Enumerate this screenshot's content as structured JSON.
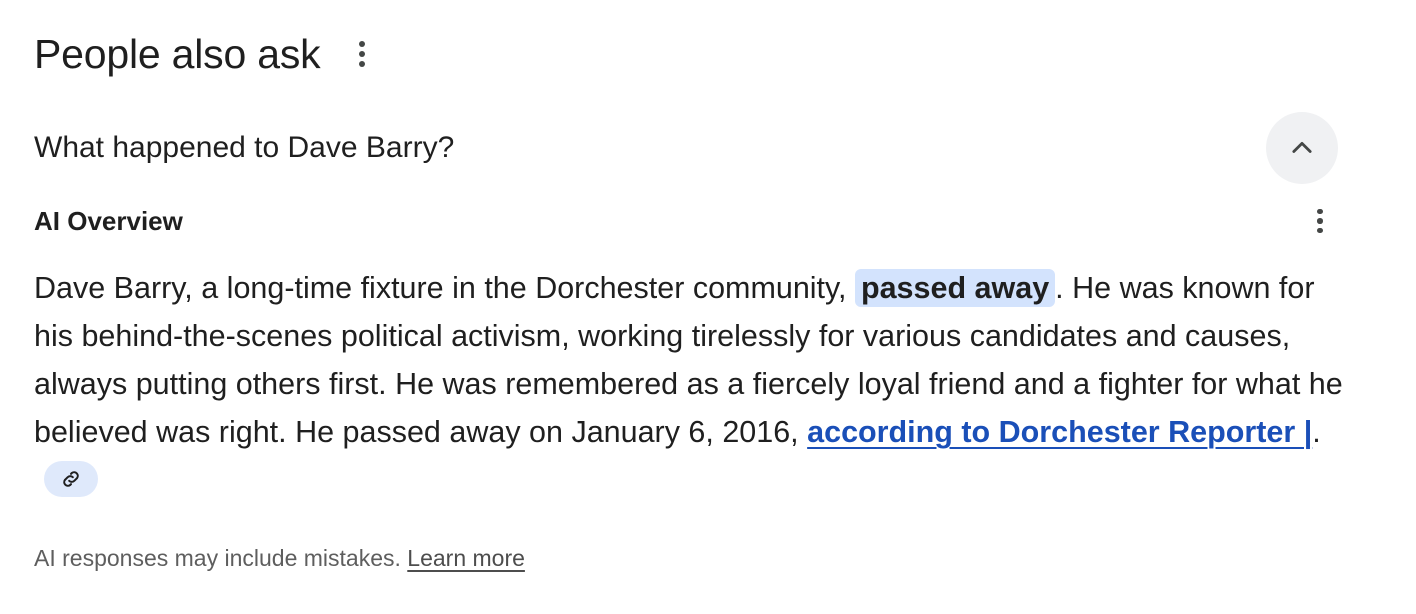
{
  "section": {
    "title": "People also ask"
  },
  "question": {
    "text": "What happened to Dave Barry?"
  },
  "overview": {
    "label": "AI Overview",
    "answer": {
      "part1": "Dave Barry, a long-time fixture in the Dorchester community, ",
      "highlight": "passed away",
      "part2": ". He was known for his behind-the-scenes political activism, working tirelessly for various candidates and causes, always putting others first. He was remembered as a fiercely loyal friend and a fighter for what he believed was right. He passed away on January 6, 2016, ",
      "link_text": "according to Dorchester Reporter |",
      "part3": "."
    }
  },
  "footer": {
    "disclaimer": "AI responses may include mistakes. ",
    "learn_more": "Learn more"
  },
  "icons": {
    "header_menu": "more-vert-icon",
    "collapse": "chevron-up-icon",
    "overview_menu": "more-vert-icon",
    "link": "link-icon"
  },
  "colors": {
    "highlight_bg": "#d3e3fd",
    "link": "#1a4fb8",
    "chip_bg": "#dfe9fb",
    "collapse_bg": "#f0f1f3"
  }
}
